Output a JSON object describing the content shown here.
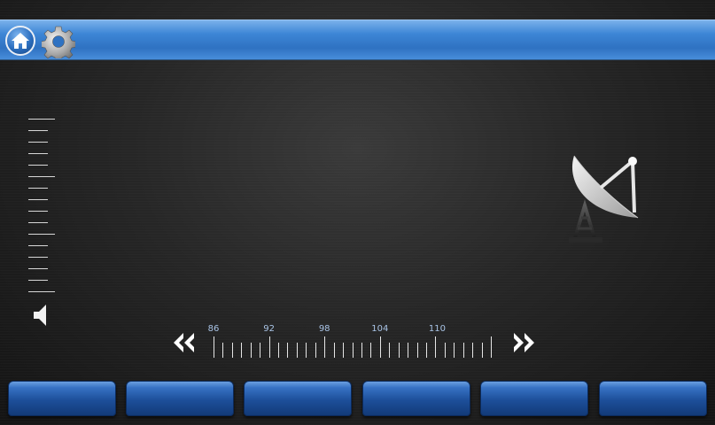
{
  "header": {
    "home_icon": "home-icon",
    "settings_icon": "gear-icon",
    "bar_color": "#3d86d6"
  },
  "volume": {
    "speaker_icon": "speaker-icon"
  },
  "source_icon": "satellite-dish-icon",
  "tuner": {
    "prev_icon": "rewind-icon",
    "next_icon": "fast-forward-icon",
    "labels": [
      "86",
      "92",
      "98",
      "104",
      "110"
    ]
  },
  "softkeys": [
    "",
    "",
    "",
    "",
    "",
    ""
  ]
}
